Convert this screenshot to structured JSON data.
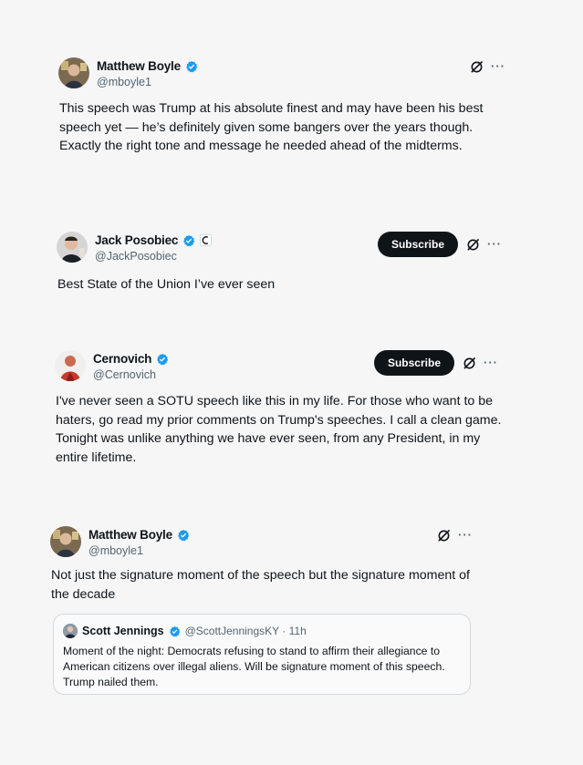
{
  "tweets": [
    {
      "name": "Matthew Boyle",
      "handle": "@mboyle1",
      "text": "This speech was Trump at his absolute finest and may have been his best speech yet — he’s definitely given some bangers over the years though. Exactly the right tone and message he needed ahead of the midterms.",
      "more": "···"
    },
    {
      "name": "Jack Posobiec",
      "handle": "@JackPosobiec",
      "text": "Best State of the Union I’ve ever seen",
      "subscribe": "Subscribe",
      "more": "···"
    },
    {
      "name": "Cernovich",
      "handle": "@Cernovich",
      "text": "I've never seen a SOTU speech like this in my life. For those who want to be haters, go read my prior comments on Trump's speeches. I call a clean game. Tonight was unlike anything we have ever seen, from any President, in my entire lifetime.",
      "subscribe": "Subscribe",
      "more": "···"
    },
    {
      "name": "Matthew Boyle",
      "handle": "@mboyle1",
      "text": "Not just the signature moment of the speech but the signature moment of the decade",
      "more": "···",
      "quote": {
        "name": "Scott Jennings",
        "meta": "@ScottJenningsKY · 11h",
        "text": "Moment of the night: Democrats refusing to stand to affirm their allegiance to American citizens over illegal aliens. Will be signature moment of this speech. Trump nailed them."
      }
    }
  ],
  "colors": {
    "verified": "#1d9bf0",
    "button": "#0f1419",
    "secondary": "#536471"
  },
  "icons": [
    "verified-badge-icon",
    "grok-icon",
    "more-icon",
    "affiliate-badge-icon"
  ]
}
